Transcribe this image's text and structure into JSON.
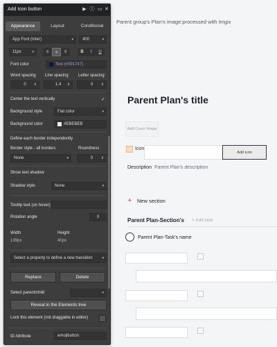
{
  "canvas": {
    "image_caption": "Parent group's Plan's image:processed with Imgix",
    "title": "Parent Plan's title",
    "cover_button": "Add Cover Image",
    "icon_label": "Icon",
    "add_icon_button": "Add icon",
    "description_label": "Description",
    "description_value": "Parent Plan's description",
    "new_section_icon": "+",
    "new_section_label": "New section",
    "section_title": "Parent Plan-Section's",
    "add_task": "+ Add task",
    "task_name": "Parent Plan-Task's name"
  },
  "panel": {
    "title": "Add Icon button",
    "titlebar_icons": [
      "play-icon",
      "info-icon",
      "comment-icon",
      "close-icon"
    ],
    "tabs": [
      "Appearance",
      "Layout",
      "Conditional"
    ],
    "active_tab": "Appearance",
    "font": {
      "family": "App Font (Inter)",
      "weight": "400",
      "size": "11px"
    },
    "font_color_label": "Font color",
    "font_color_value": "Text (#091747)",
    "font_color_swatch": "#091747",
    "word_spacing_label": "Word spacing",
    "line_spacing_label": "Line spacing",
    "letter_spacing_label": "Letter spacing",
    "word_spacing_value": "0",
    "line_spacing_value": "1.4",
    "letter_spacing_value": "0",
    "center_vertically_label": "Center the text vertically",
    "center_vertically_checked": "✓",
    "bg_style_label": "Background style",
    "bg_style_value": "Flat color",
    "bg_color_label": "Background color",
    "bg_color_value": "#EBEBEB",
    "bg_color_swatch": "#EBEBEB",
    "border_independent_label": "Define each border independently",
    "border_style_label": "Border style - all borders",
    "roundness_label": "Roundness",
    "border_style_value": "None",
    "roundness_value": "0",
    "text_shadow_label": "Show text shadow",
    "shadow_style_label": "Shadow style",
    "shadow_style_value": "None",
    "tooltip_label": "Tooltip text (on hover)",
    "rotation_label": "Rotation angle",
    "rotation_value": "0",
    "width_label": "Width",
    "width_value": "139px",
    "height_label": "Height",
    "height_value": "40px",
    "transition_select": "Select a property to define a new transition",
    "replace_button": "Replace",
    "delete_button": "Delete",
    "select_parent_label": "Select parent/child",
    "reveal_button": "Reveal in the Elements tree",
    "lock_label": "Lock this element (not draggable in editor)",
    "id_attribute_label": "ID Attribute",
    "id_attribute_value": "emojibutton"
  }
}
